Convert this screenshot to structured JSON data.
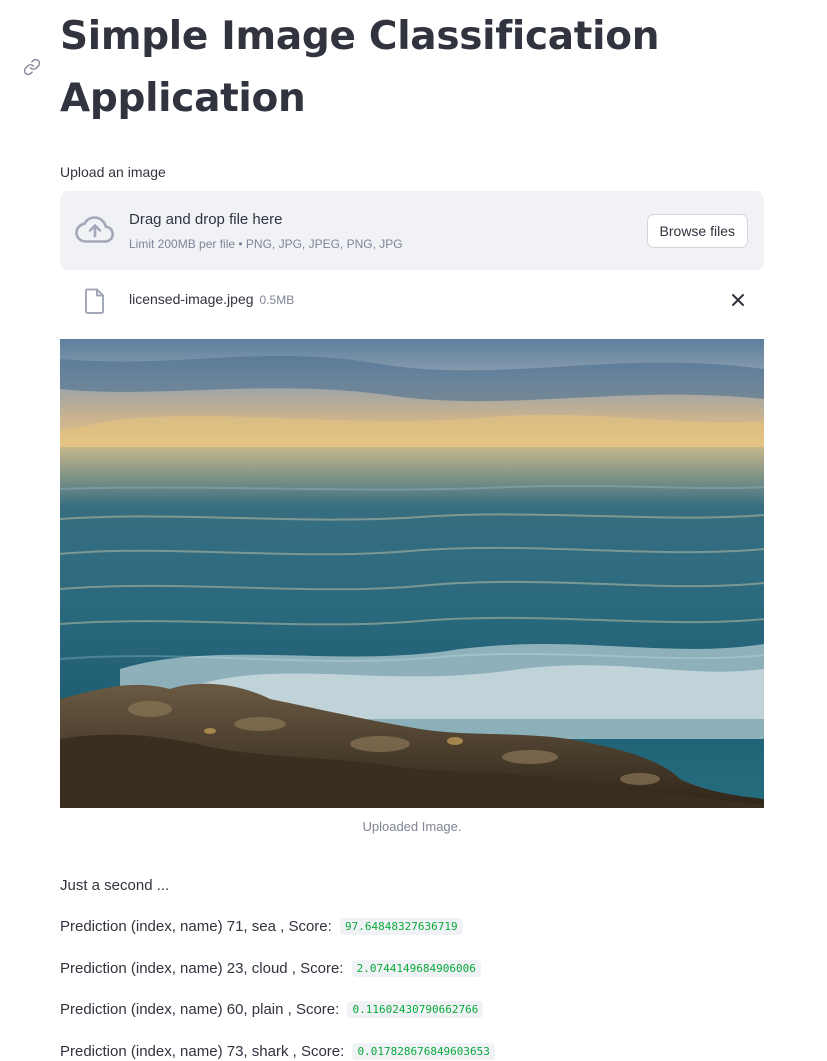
{
  "header": {
    "title": "Simple Image Classification Application"
  },
  "uploader": {
    "label": "Upload an image",
    "drop_text": "Drag and drop file here",
    "limit_text": "Limit 200MB per file • PNG, JPG, JPEG, PNG, JPG",
    "browse_label": "Browse files",
    "icon": "cloud-upload-icon"
  },
  "file": {
    "name": "licensed-image.jpeg",
    "size": "0.5MB",
    "icon": "file-icon"
  },
  "image": {
    "caption": "Uploaded Image."
  },
  "status": "Just a second ...",
  "predictions": [
    {
      "label": "Prediction (index, name) 71, sea , Score:",
      "score": "97.64848327636719"
    },
    {
      "label": "Prediction (index, name) 23, cloud , Score:",
      "score": "2.0744149684906006"
    },
    {
      "label": "Prediction (index, name) 60, plain , Score:",
      "score": "0.11602430790662766"
    },
    {
      "label": "Prediction (index, name) 73, shark , Score:",
      "score": "0.017828676849603653"
    }
  ],
  "colors": {
    "text": "#31333f",
    "muted": "#808495",
    "dropzone_bg": "#f0f2f6",
    "score_green": "#09ab3b"
  }
}
